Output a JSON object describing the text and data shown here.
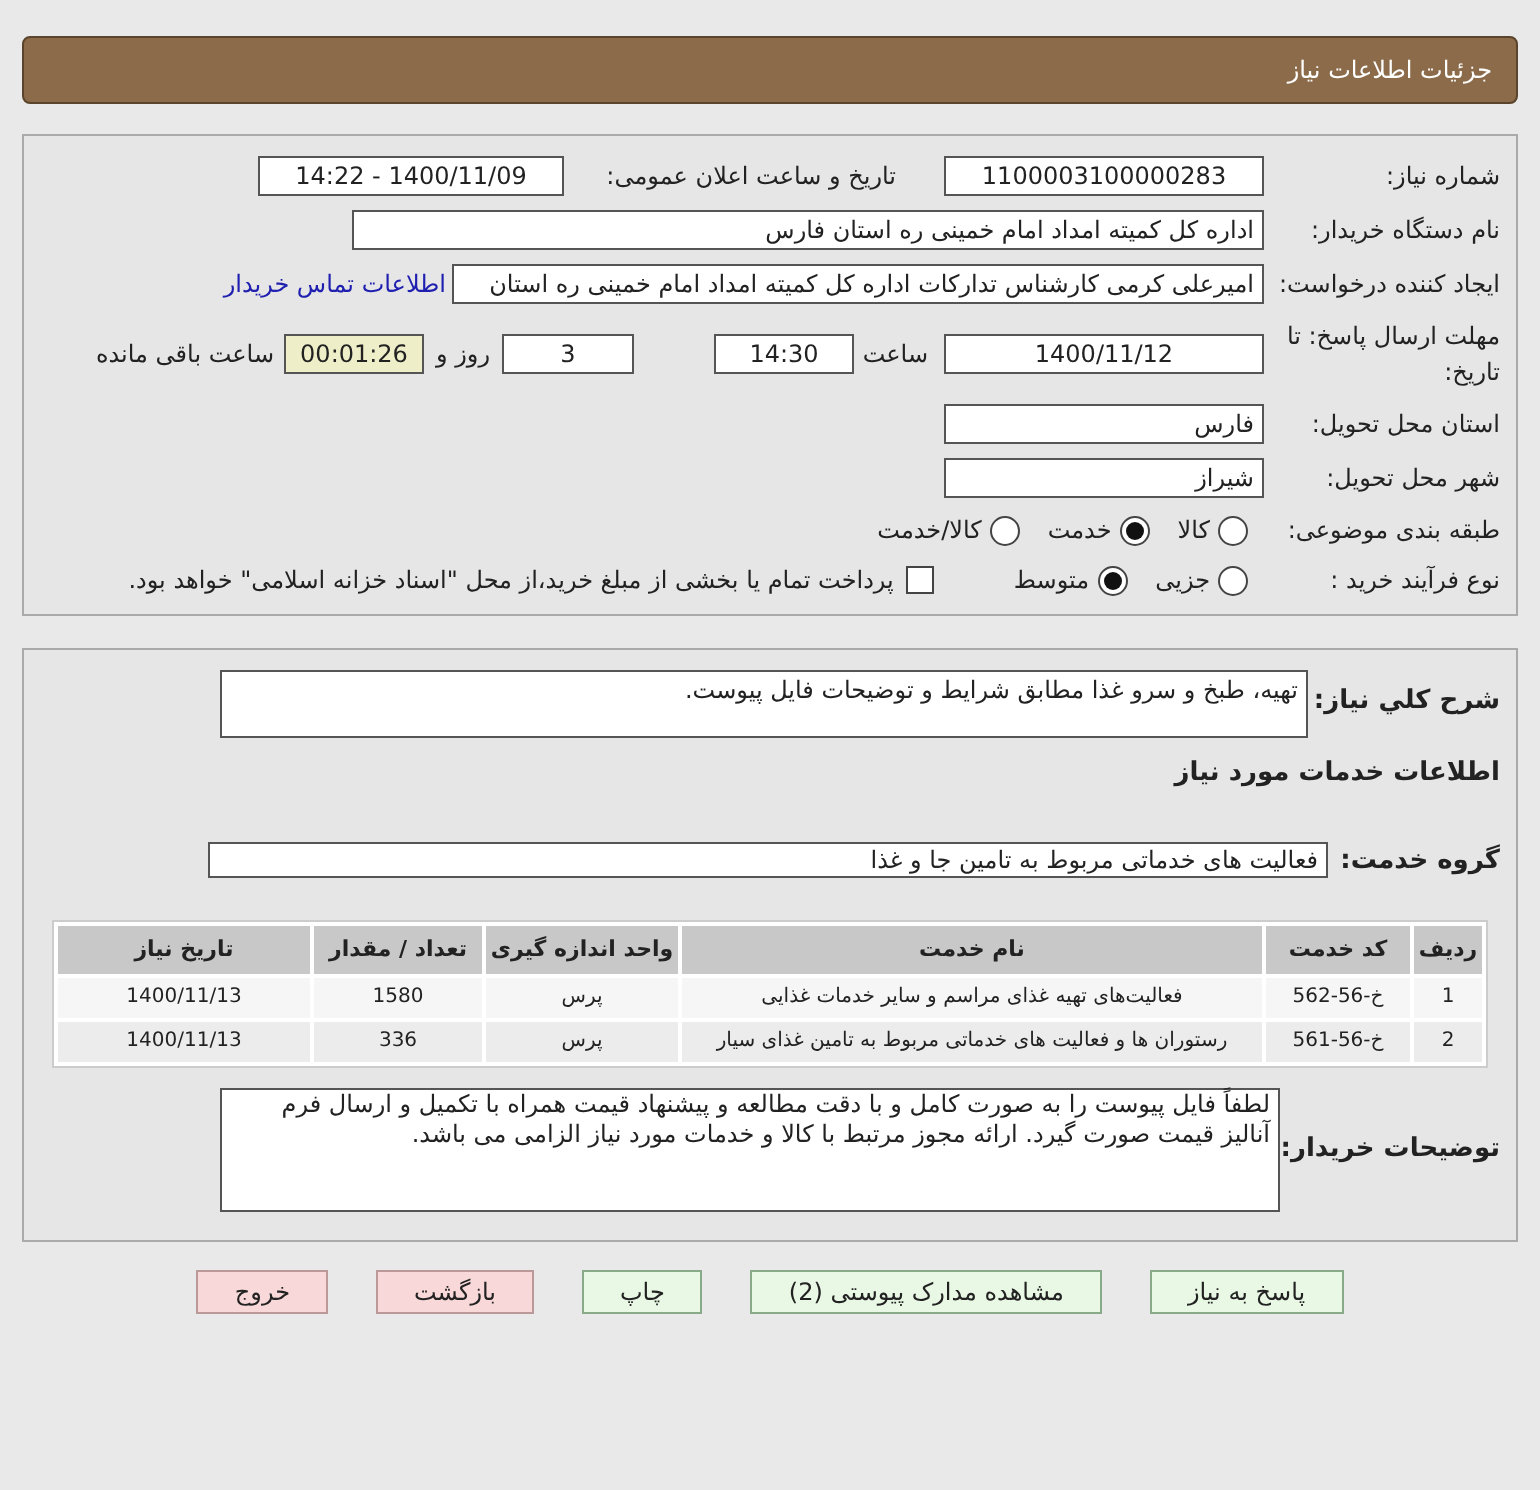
{
  "header": {
    "title": "جزئیات اطلاعات نیاز"
  },
  "need_number": {
    "label": "شماره نیاز:",
    "value": "1100003100000283"
  },
  "announce": {
    "label": "تاریخ و ساعت اعلان عمومی:",
    "value": "1400/11/09 - 14:22"
  },
  "buyer": {
    "label": "نام دستگاه خریدار:",
    "value": "اداره کل کمیته امداد امام خمینی  ره  استان فارس"
  },
  "creator": {
    "label": "ایجاد کننده درخواست:",
    "value": "امیرعلی کرمی کارشناس تدارکات اداره کل کمیته امداد امام خمینی  ره  استان",
    "link": "اطلاعات تماس خریدار"
  },
  "deadline": {
    "label": "مهلت ارسال پاسخ: تا تاریخ:",
    "date": "1400/11/12",
    "time_label": "ساعت",
    "time": "14:30",
    "days": "3",
    "days_label": "روز و",
    "remaining": "00:01:26",
    "remaining_label": "ساعت باقی مانده"
  },
  "province": {
    "label": "استان محل تحویل:",
    "value": "فارس"
  },
  "city": {
    "label": "شهر محل تحویل:",
    "value": "شیراز"
  },
  "category": {
    "label": "طبقه بندی موضوعی:",
    "options": [
      {
        "label": "کالا",
        "selected": false
      },
      {
        "label": "خدمت",
        "selected": true
      },
      {
        "label": "کالا/خدمت",
        "selected": false
      }
    ]
  },
  "process": {
    "label": "نوع فرآیند خرید :",
    "options": [
      {
        "label": "جزیی",
        "selected": false
      },
      {
        "label": "متوسط",
        "selected": true
      }
    ],
    "payment": {
      "label": "پرداخت تمام یا بخشی از مبلغ خرید،از محل \"اسناد خزانه اسلامی\" خواهد بود.",
      "checked": false
    }
  },
  "summary": {
    "label": "شرح کلي نياز:",
    "value": "تهیه، طبخ و سرو غذا مطابق شرایط و توضیحات فایل پیوست."
  },
  "services_heading": "اطلاعات خدمات مورد نياز",
  "service_group": {
    "label": "گروه خدمت:",
    "value": "فعالیت های خدماتی مربوط به تامین جا و غذا"
  },
  "table": {
    "columns": [
      "ردیف",
      "کد خدمت",
      "نام خدمت",
      "واحد اندازه گیری",
      "تعداد / مقدار",
      "تاریخ نیاز"
    ],
    "rows": [
      [
        "1",
        "خ-56-562",
        "فعالیت‌های تهیه غذای مراسم و سایر خدمات غذایی",
        "پرس",
        "1580",
        "1400/11/13"
      ],
      [
        "2",
        "خ-56-561",
        "رستوران ها و فعالیت های خدماتی مربوط به تامین غذای سیار",
        "پرس",
        "336",
        "1400/11/13"
      ]
    ]
  },
  "buyer_notes": {
    "label": "توضیحات خریدار:",
    "value": "لطفاً فایل پیوست را به صورت کامل و با دقت مطالعه و پیشنهاد قیمت همراه با تکمیل و ارسال فرم آنالیز قیمت صورت گیرد. ارائه مجوز مرتبط با کالا و خدمات مورد نیاز الزامی می باشد."
  },
  "buttons": [
    {
      "label": "پاسخ به نیاز",
      "kind": "normal"
    },
    {
      "label": "مشاهده مدارک پیوستی (2)",
      "kind": "normal"
    },
    {
      "label": "چاپ",
      "kind": "normal"
    },
    {
      "label": "بازگشت",
      "kind": "danger"
    },
    {
      "label": "خروج",
      "kind": "danger"
    }
  ]
}
